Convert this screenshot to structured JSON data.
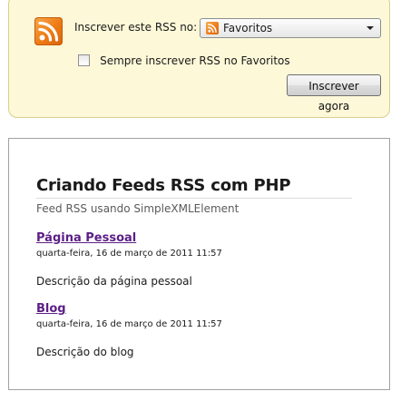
{
  "subscribe": {
    "label": "Inscrever este RSS no:",
    "select_value": "Favoritos",
    "always_label": "Sempre inscrever RSS no Favoritos",
    "always_checked": false,
    "button_label": "Inscrever agora"
  },
  "feed": {
    "title": "Criando Feeds RSS com PHP",
    "subtitle": "Feed RSS usando SimpleXMLElement",
    "entries": [
      {
        "title": "Página Pessoal",
        "date": "quarta-feira, 16 de março de 2011 11:57",
        "description": "Descrição da página pessoal"
      },
      {
        "title": "Blog",
        "date": "quarta-feira, 16 de março de 2011 11:57",
        "description": "Descrição do blog"
      }
    ]
  },
  "icons": {
    "feed_icon": "rss-feed-icon",
    "dropdown_icon": "chevron-down-icon"
  },
  "colors": {
    "panel_background": "#fcf8d8",
    "visited_link": "#5b1f85",
    "rss_orange": "#ee7a14"
  }
}
